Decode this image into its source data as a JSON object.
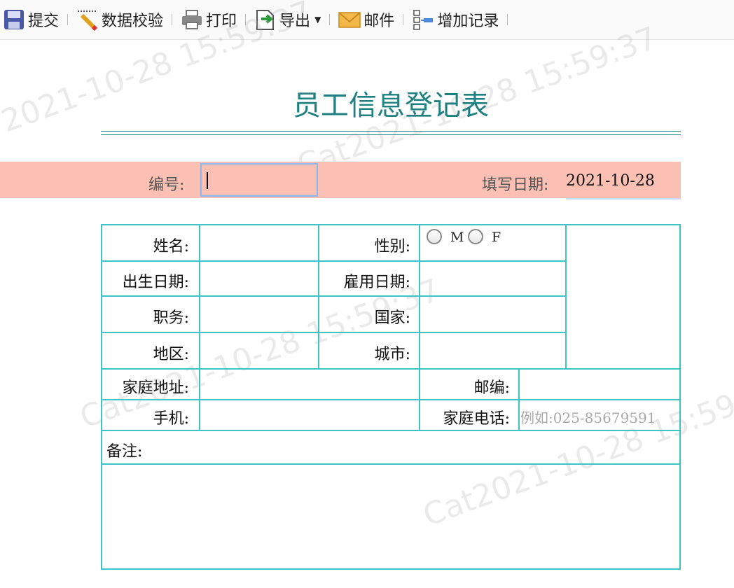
{
  "toolbar": {
    "submit": "提交",
    "validate": "数据校验",
    "print": "打印",
    "export": "导出",
    "mail": "邮件",
    "add_record": "增加记录"
  },
  "watermark": {
    "text1": "2021-10-28 15:59:37",
    "text2": "Cat2021-10-28 15:59:37"
  },
  "title": "员工信息登记表",
  "header_fields": {
    "id_label": "编号:",
    "id_value": "",
    "date_label": "填写日期:",
    "date_value": "2021-10-28"
  },
  "form": {
    "name_label": "姓名:",
    "gender_label": "性别:",
    "gender_options": [
      "M",
      "F"
    ],
    "birth_label": "出生日期:",
    "hire_label": "雇用日期:",
    "title_label": "职务:",
    "country_label": "国家:",
    "region_label": "地区:",
    "city_label": "城市:",
    "address_label": "家庭地址:",
    "zip_label": "邮编:",
    "mobile_label": "手机:",
    "home_phone_label": "家庭电话:",
    "home_phone_placeholder": "例如:025-85679591",
    "notes_label": "备注:"
  },
  "colors": {
    "accent": "#1e8080",
    "band": "#fbbfb3",
    "grid": "#3ec3c6",
    "focus": "#8bb8ee"
  },
  "icons": [
    "save-icon",
    "validate-icon",
    "print-icon",
    "export-icon",
    "mail-icon",
    "add-record-icon"
  ]
}
